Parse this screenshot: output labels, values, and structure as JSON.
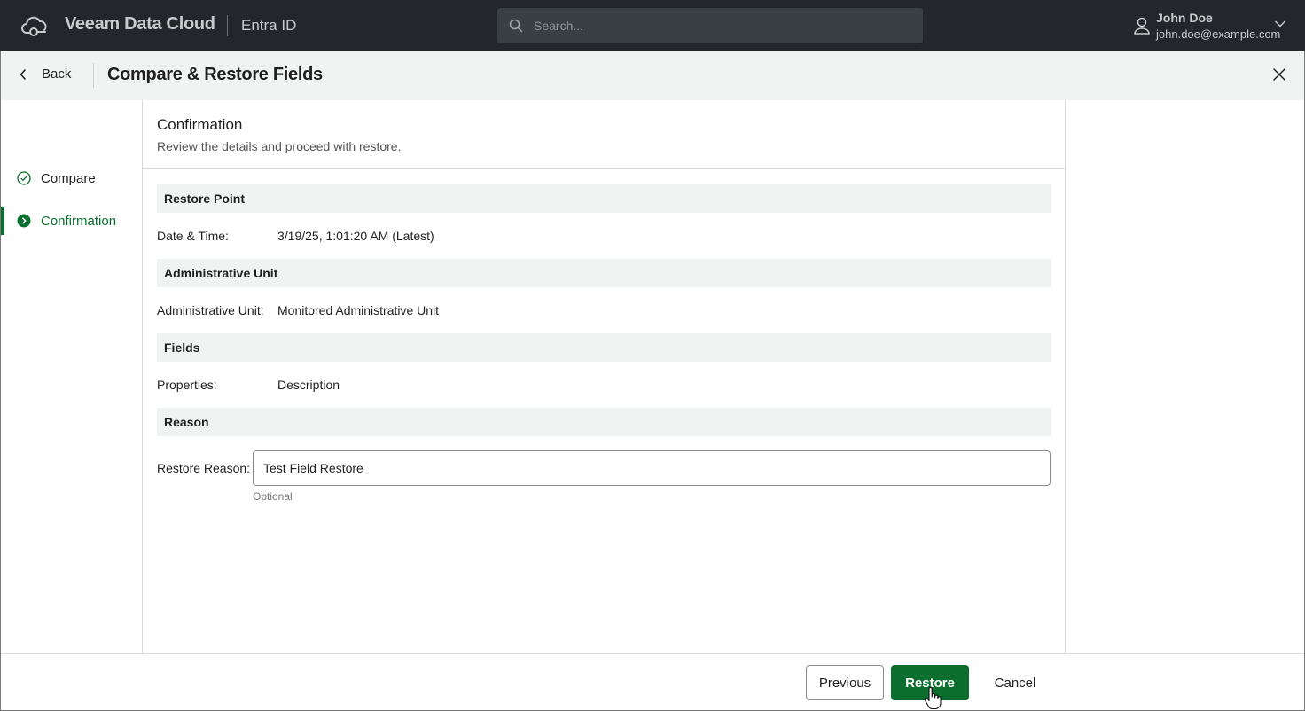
{
  "topbar": {
    "brand": "Veeam Data Cloud",
    "product": "Entra ID",
    "search_placeholder": "Search...",
    "user_name": "John Doe",
    "user_email": "john.doe@example.com"
  },
  "dialog": {
    "back_label": "Back",
    "title": "Compare & Restore Fields"
  },
  "steps": [
    {
      "label": "Compare",
      "state": "completed"
    },
    {
      "label": "Confirmation",
      "state": "active"
    }
  ],
  "content": {
    "title": "Confirmation",
    "subtitle": "Review the details and proceed with restore.",
    "sections": {
      "restore_point": {
        "heading": "Restore Point",
        "label": "Date & Time:",
        "value": "3/19/25, 1:01:20 AM (Latest)"
      },
      "admin_unit": {
        "heading": "Administrative Unit",
        "label": "Administrative Unit:",
        "value": "Monitored Administrative Unit"
      },
      "fields": {
        "heading": "Fields",
        "label": "Properties:",
        "value": "Description"
      },
      "reason": {
        "heading": "Reason",
        "label": "Restore Reason:",
        "value": "Test Field Restore",
        "hint": "Optional"
      }
    }
  },
  "footer": {
    "previous_label": "Previous",
    "restore_label": "Restore",
    "cancel_label": "Cancel"
  },
  "colors": {
    "accent": "#0b6e2e",
    "topbar": "#23272c",
    "section_bg": "#f1f2f2"
  }
}
